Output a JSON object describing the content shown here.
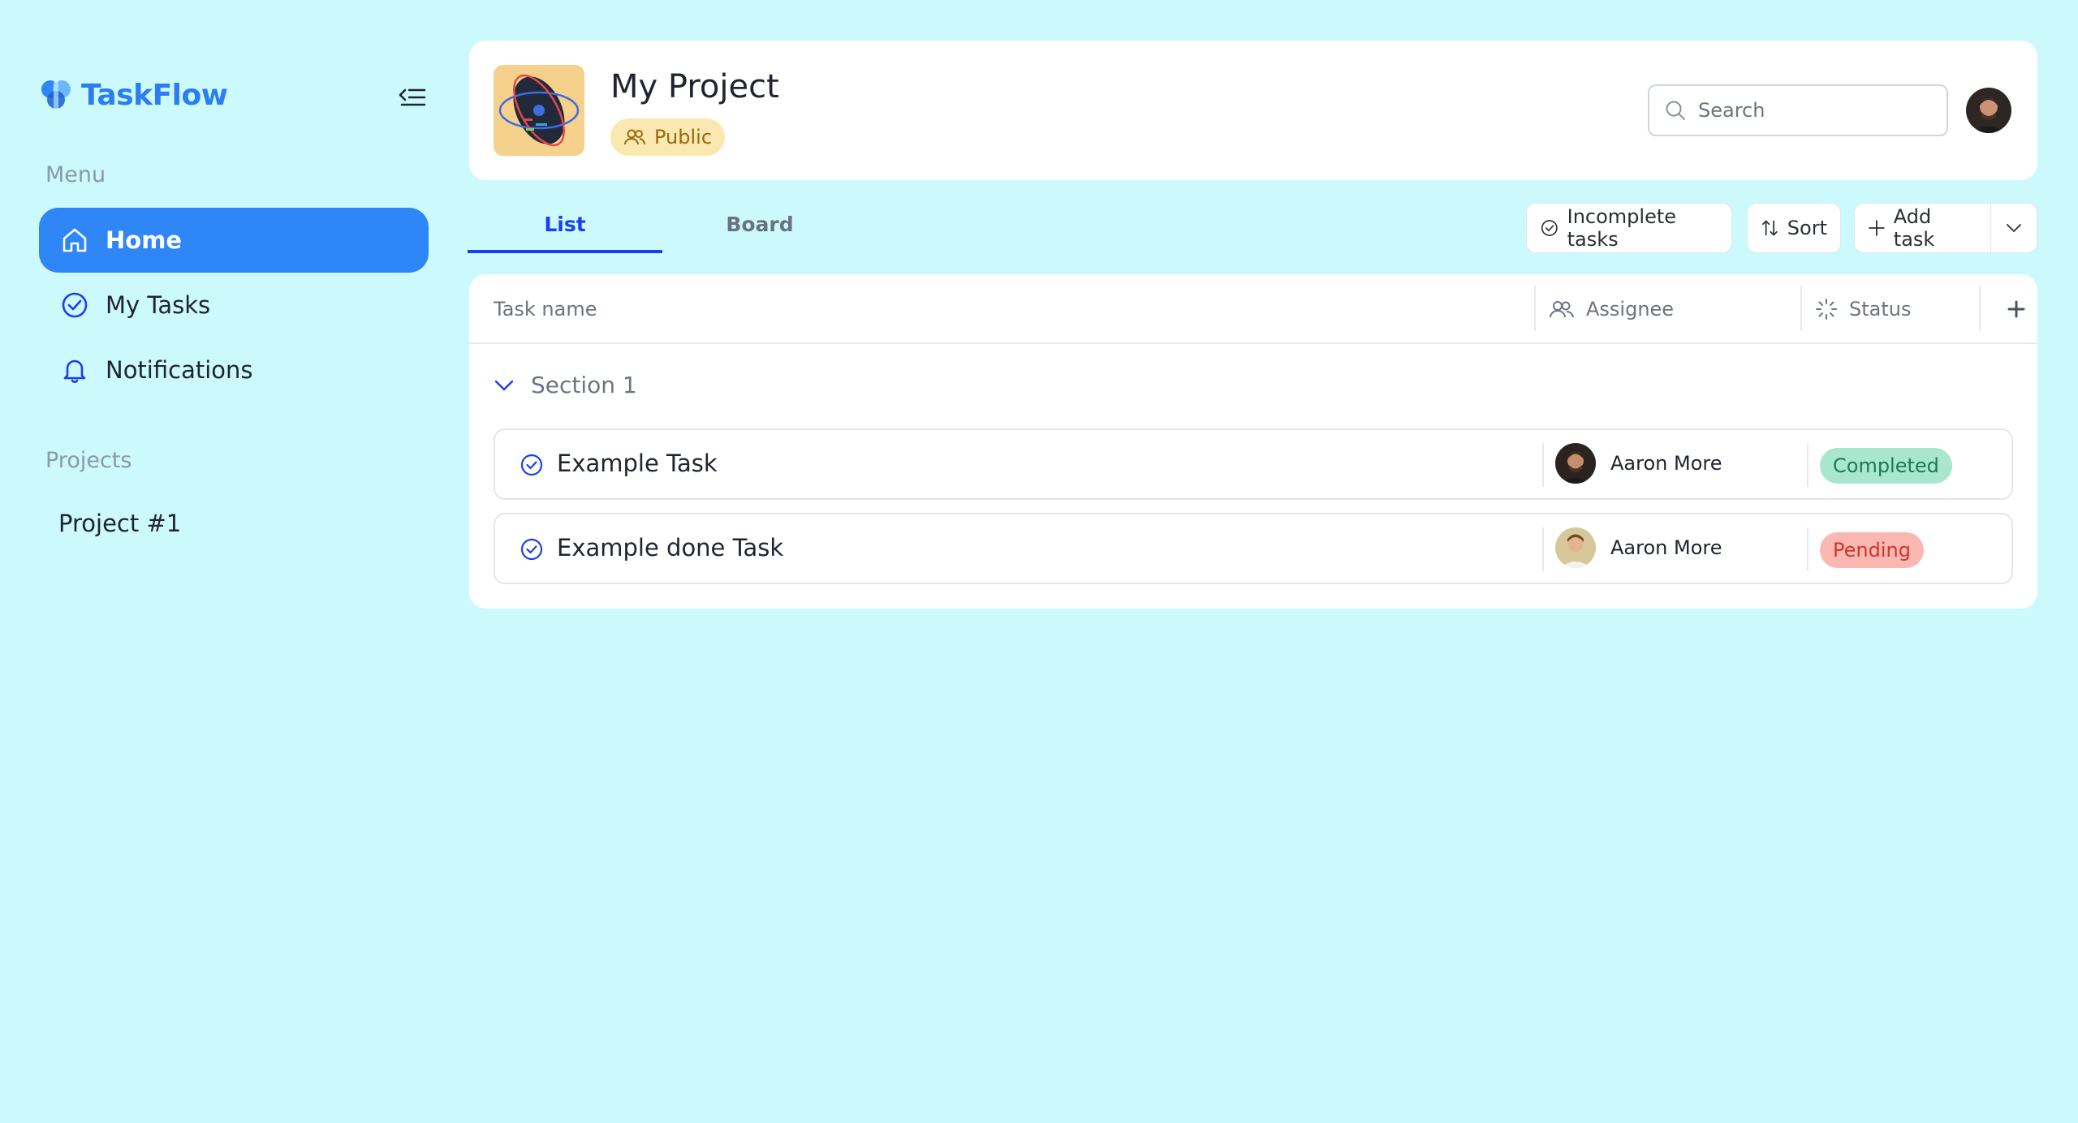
{
  "app": {
    "name": "TaskFlow",
    "brand_color": "#2f86f6"
  },
  "sidebar": {
    "menu_label": "Menu",
    "items": [
      {
        "label": "Home",
        "icon": "home-icon",
        "active": true
      },
      {
        "label": "My Tasks",
        "icon": "check-circle-icon",
        "active": false
      },
      {
        "label": "Notifications",
        "icon": "bell-icon",
        "active": false
      }
    ],
    "projects_label": "Projects",
    "projects": [
      {
        "label": "Project #1"
      }
    ]
  },
  "header": {
    "project_title": "My Project",
    "visibility": "Public",
    "search_placeholder": "Search"
  },
  "tabs": [
    {
      "label": "List",
      "active": true
    },
    {
      "label": "Board",
      "active": false
    }
  ],
  "toolbar": {
    "filter_label": "Incomplete tasks",
    "sort_label": "Sort",
    "add_label": "Add task"
  },
  "table": {
    "columns": {
      "name": "Task name",
      "assignee": "Assignee",
      "status": "Status"
    },
    "sections": [
      {
        "title": "Section 1",
        "tasks": [
          {
            "name": "Example Task",
            "assignee": "Aaron More",
            "status": "Completed",
            "status_color": "#a8e6cf"
          },
          {
            "name": "Example done Task",
            "assignee": "Aaron More",
            "status": "Pending",
            "status_color": "#f9b8b2"
          }
        ]
      }
    ]
  }
}
